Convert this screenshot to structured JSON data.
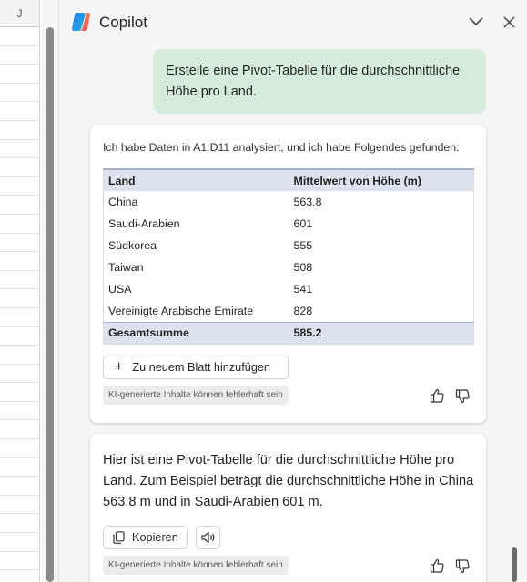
{
  "sheet": {
    "column_header": "J"
  },
  "copilot": {
    "title": "Copilot",
    "user_prompt": "Erstelle eine Pivot-Tabelle für die durchschnittliche Höhe pro Land.",
    "response_card": {
      "intro": "Ich habe Daten in A1:D11 analysiert, und ich habe Folgendes gefunden:",
      "table": {
        "headers": [
          "Land",
          "Mittelwert von Höhe (m)"
        ],
        "rows": [
          [
            "China",
            "563.8"
          ],
          [
            "Saudi-Arabien",
            "601"
          ],
          [
            "Südkorea",
            "555"
          ],
          [
            "Taiwan",
            "508"
          ],
          [
            "USA",
            "541"
          ],
          [
            "Vereinigte Arabische Emirate",
            "828"
          ]
        ],
        "total": [
          "Gesamtsumme",
          "585.2"
        ]
      },
      "add_button": "Zu neuem Blatt hinzufügen",
      "disclaimer": "KI-generierte Inhalte können fehlerhaft sein"
    },
    "answer_card": {
      "text": "Hier ist eine Pivot-Tabelle für die durchschnittliche Höhe pro Land. Zum Beispiel beträgt die durchschnittliche Höhe in China 563,8 m und in Saudi-Arabien 601 m.",
      "copy_button": "Kopieren",
      "disclaimer": "KI-generierte Inhalte können fehlerhaft sein"
    },
    "icons": {
      "logo": "copilot-logo",
      "collapse": "chevron-down-icon",
      "close": "close-icon",
      "plus": "plus-icon",
      "like": "thumbs-up-icon",
      "dislike": "thumbs-down-icon",
      "copy": "copy-icon",
      "speak": "speaker-icon"
    },
    "colors": {
      "user_bubble": "#d4ecd9",
      "table_header": "#dce3ee",
      "pane_bg": "#f5f5f5"
    }
  }
}
